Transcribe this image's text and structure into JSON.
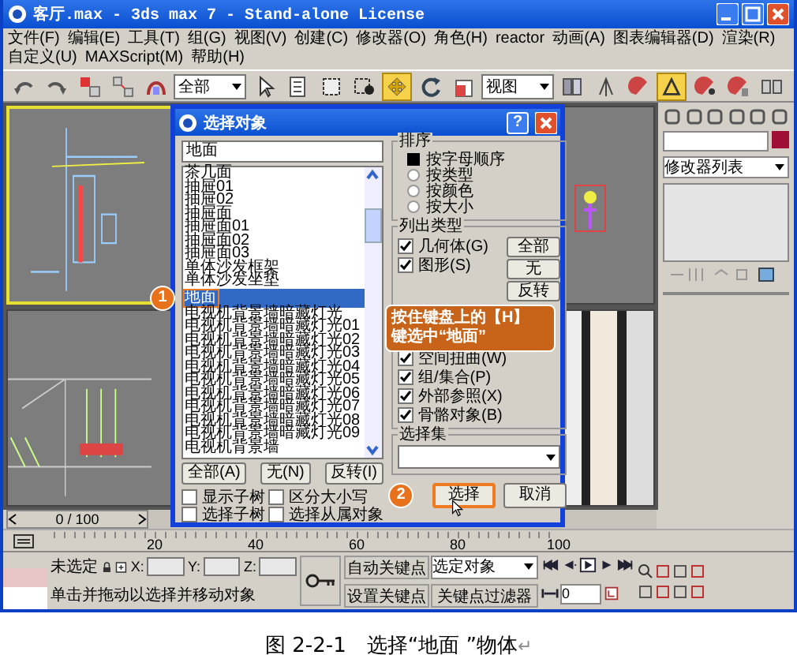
{
  "window": {
    "title": "客厅.max - 3ds max 7 - Stand-alone License"
  },
  "menu": [
    "文件(F)",
    "编辑(E)",
    "工具(T)",
    "组(G)",
    "视图(V)",
    "创建(C)",
    "修改器(O)",
    "角色(H)",
    "reactor",
    "动画(A)",
    "图表编辑器(D)",
    "渲染(R)",
    "自定义(U)",
    "MAXScript(M)",
    "帮助(H)"
  ],
  "toolbar": [
    {
      "kind": "undo",
      "selected": false
    },
    {
      "kind": "redo",
      "selected": false
    },
    {
      "kind": "link",
      "selected": false
    },
    {
      "kind": "unlink",
      "selected": false
    },
    {
      "kind": "bind",
      "selected": false
    },
    {
      "kind": "dropdown",
      "value": "全部"
    },
    {
      "kind": "select",
      "selected": false
    },
    {
      "kind": "selectname",
      "selected": false
    },
    {
      "kind": "rectsel",
      "selected": false
    },
    {
      "kind": "windowsel",
      "selected": false
    },
    {
      "kind": "move",
      "selected": true
    },
    {
      "kind": "rotate",
      "selected": false
    },
    {
      "kind": "scale",
      "selected": false
    },
    {
      "kind": "dropdown",
      "value": "视图"
    },
    {
      "kind": "pivot",
      "selected": false
    },
    {
      "kind": "mirror",
      "selected": false
    },
    {
      "kind": "snap",
      "selected": false
    },
    {
      "kind": "anglesnap",
      "selected": true
    },
    {
      "kind": "percentsnap",
      "selected": false
    },
    {
      "kind": "spinsnap",
      "selected": false
    },
    {
      "kind": "named",
      "selected": false
    }
  ],
  "dialog": {
    "title": "选择对象",
    "help": "?",
    "search_value": "地面",
    "objects": [
      {
        "name": "茶几面",
        "selected": false
      },
      {
        "name": "抽屉01",
        "selected": false
      },
      {
        "name": "抽屉02",
        "selected": false
      },
      {
        "name": "抽屉面",
        "selected": false
      },
      {
        "name": "抽屉面01",
        "selected": false
      },
      {
        "name": "抽屉面02",
        "selected": false
      },
      {
        "name": "抽屉面03",
        "selected": false
      },
      {
        "name": "单体沙发框架",
        "selected": false
      },
      {
        "name": "单体沙发坐垫",
        "selected": false
      },
      {
        "name": "地面",
        "selected": true
      },
      {
        "name": "电视机背景墙暗藏灯光",
        "selected": false
      },
      {
        "name": "电视机背景墙暗藏灯光01",
        "selected": false
      },
      {
        "name": "电视机背景墙暗藏灯光02",
        "selected": false
      },
      {
        "name": "电视机背景墙暗藏灯光03",
        "selected": false
      },
      {
        "name": "电视机背景墙暗藏灯光04",
        "selected": false
      },
      {
        "name": "电视机背景墙暗藏灯光05",
        "selected": false
      },
      {
        "name": "电视机背景墙暗藏灯光06",
        "selected": false
      },
      {
        "name": "电视机背景墙暗藏灯光07",
        "selected": false
      },
      {
        "name": "电视机背景墙暗藏灯光08",
        "selected": false
      },
      {
        "name": "电视机背景墙暗藏灯光09",
        "selected": false
      },
      {
        "name": "电视机背景墙",
        "selected": false
      }
    ],
    "list_buttons": [
      "全部(A)",
      "无(N)",
      "反转(I)"
    ],
    "options": [
      {
        "label": "显示子树",
        "checked": false
      },
      {
        "label": "区分大小写",
        "checked": false
      },
      {
        "label": "选择子树",
        "checked": false
      },
      {
        "label": "选择从属对象",
        "checked": false
      }
    ],
    "sort": {
      "title": "排序",
      "options": [
        {
          "label": "按字母顺序",
          "selected": true
        },
        {
          "label": "按类型",
          "selected": false
        },
        {
          "label": "按颜色",
          "selected": false
        },
        {
          "label": "按大小",
          "selected": false
        }
      ]
    },
    "list_types": {
      "title": "列出类型",
      "top_items": [
        {
          "label": "几何体(G)",
          "checked": true
        },
        {
          "label": "图形(S)",
          "checked": true
        }
      ],
      "bottom_items": [
        {
          "label": "空间扭曲(W)",
          "checked": true
        },
        {
          "label": "组/集合(P)",
          "checked": true
        },
        {
          "label": "外部参照(X)",
          "checked": true
        },
        {
          "label": "骨骼对象(B)",
          "checked": true
        }
      ],
      "buttons": [
        "全部",
        "无",
        "反转"
      ]
    },
    "selection_set": {
      "title": "选择集"
    },
    "select_button": "选择",
    "cancel_button": "取消"
  },
  "callout": {
    "number": "1",
    "lines": [
      "按住键盘上的【H】",
      "键选中“地面”"
    ]
  },
  "step_two": {
    "number": "2"
  },
  "command_panel": {
    "modifier_list": "修改器列表"
  },
  "timeline": {
    "slider": "0 / 100",
    "level": 0,
    "ruler_labels": [
      "20",
      "40",
      "60",
      "80",
      "100"
    ]
  },
  "status": {
    "selection": "未选定",
    "x_label": "X:",
    "y_label": "Y:",
    "z_label": "Z:",
    "auto_key": "自动关键点",
    "key_target": "选定对象",
    "set_key": "设置关键点",
    "key_filters": "关键点过滤器",
    "frame": "0",
    "prompt": "单击并拖动以选择并移动对象"
  },
  "caption": {
    "text": "图 2-2-1　选择“地面 ”物体",
    "mark": "↵"
  }
}
